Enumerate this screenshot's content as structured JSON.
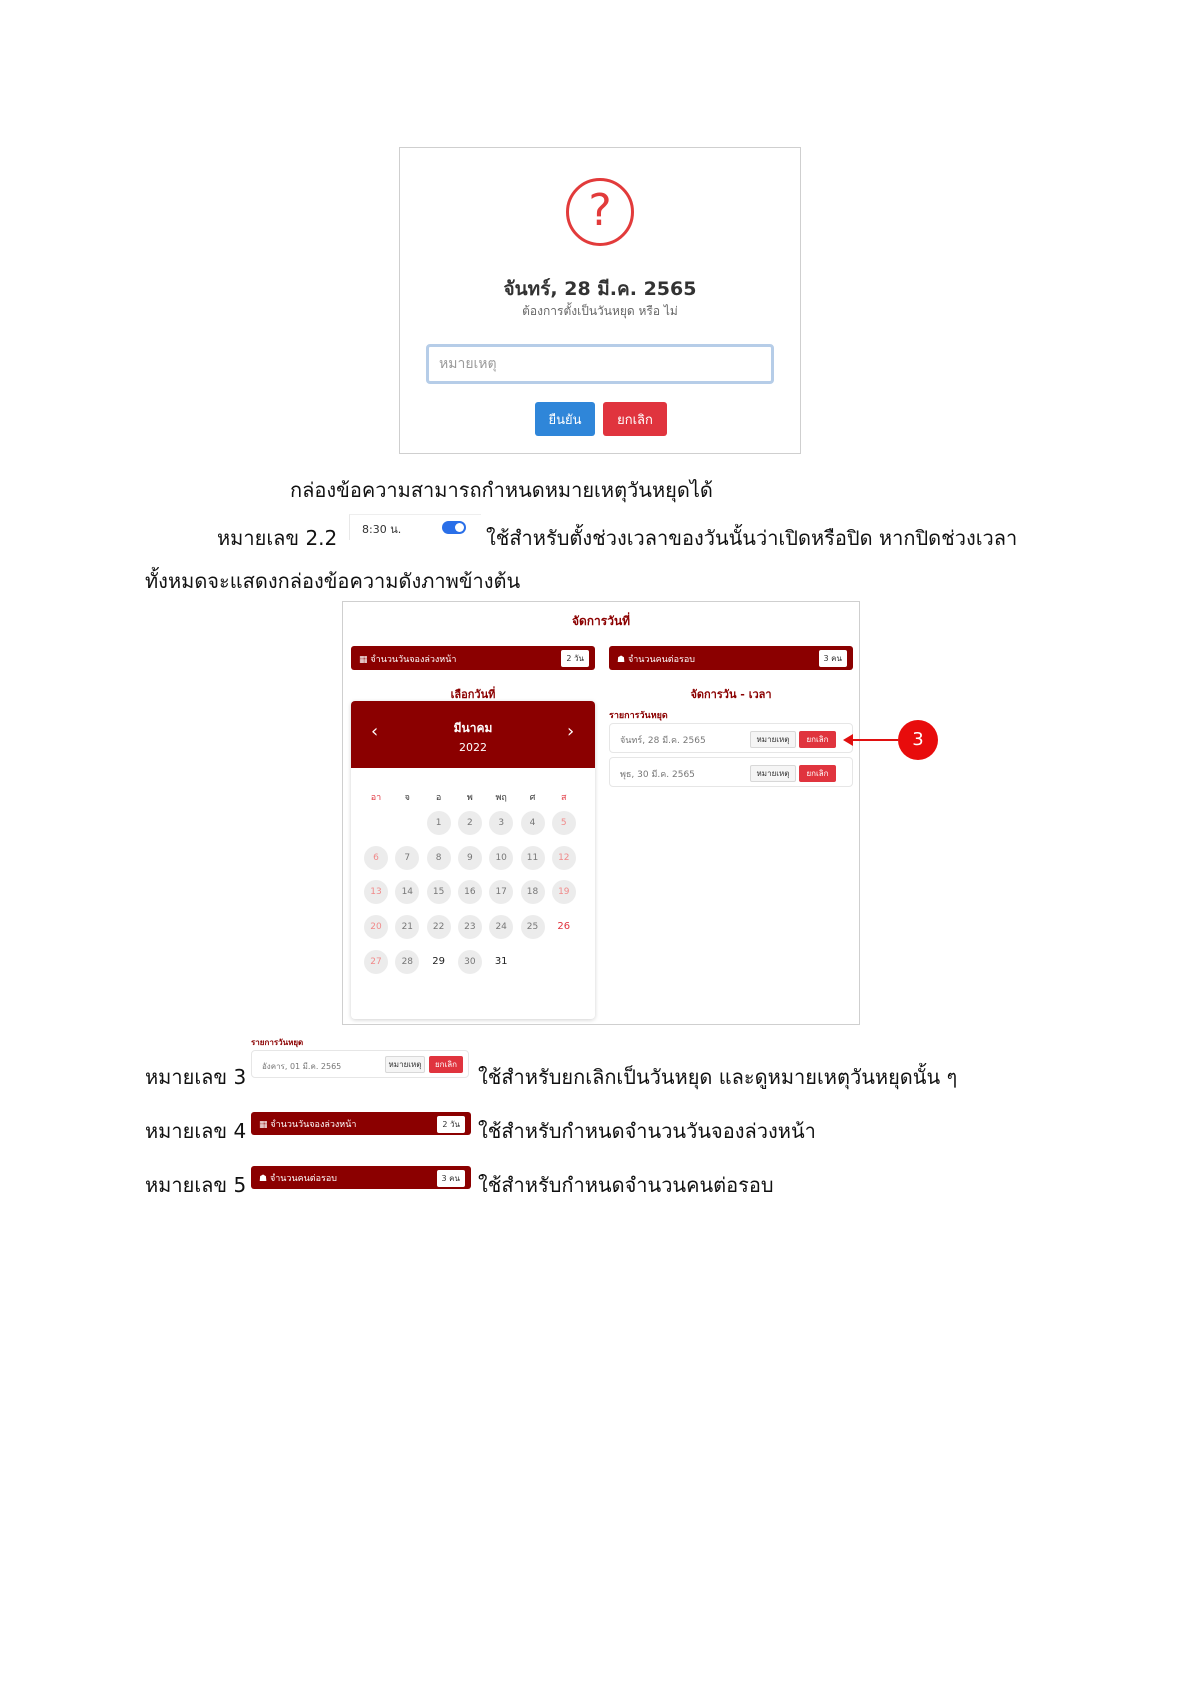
{
  "dialog": {
    "icon": "question-icon",
    "icon_glyph": "?",
    "title": "จันทร์, 28 มี.ค. 2565",
    "subtitle": "ต้องการตั้งเป็นวันหยุด หรือ ไม่",
    "input_placeholder": "หมายเหตุ",
    "confirm_label": "ยืนยัน",
    "cancel_label": "ยกเลิก"
  },
  "doc": {
    "caption": "กล่องข้อความสามารถกำหนดหมายเหตุวันหยุดได้",
    "item_22_label": "หมายเลข 2.2",
    "item_22_text": "ใช้สำหรับตั้งช่วงเวลาของวันนั้นว่าเปิดหรือปิด หากปิดช่วงเวลา",
    "item_22_text2": "ทั้งหมดจะแสดงกล่องข้อความดังภาพข้างต้น",
    "time_slot": "8:30 น.",
    "item_3_label": "หมายเลข 3",
    "item_3_text": "ใช้สำหรับยกเลิกเป็นวันหยุด และดูหมายเหตุวันหยุดนั้น ๆ",
    "item_4_label": "หมายเลข 4",
    "item_4_text": "ใช้สำหรับกำหนดจำนวนวันจองล่วงหน้า",
    "item_5_label": "หมายเลข 5",
    "item_5_text": "ใช้สำหรับกำหนดจำนวนคนต่อรอบ"
  },
  "manage": {
    "title": "จัดการวันที่",
    "advance_days_label": "จำนวนวันจองล่วงหน้า",
    "advance_days_badge": "2 วัน",
    "per_round_label": "จำนวนคนต่อรอบ",
    "per_round_badge": "3 คน",
    "select_day_title": "เลือกวันที่",
    "manage_day_title": "จัดการวัน - เวลา",
    "month": "มีนาคม",
    "year": "2022",
    "prev": "‹",
    "next": "›",
    "weekdays": [
      "อา",
      "จ",
      "อ",
      "พ",
      "พฤ",
      "ศ",
      "ส"
    ],
    "holiday_list_title": "รายการวันหยุด",
    "holidays": [
      {
        "date": "จันทร์, 28 มี.ค. 2565",
        "note_label": "หมายเหตุ",
        "cancel_label": "ยกเลิก"
      },
      {
        "date": "พุธ, 30 มี.ค. 2565",
        "note_label": "หมายเหตุ",
        "cancel_label": "ยกเลิก"
      }
    ],
    "annotation_number": "3"
  },
  "snippet3": {
    "title": "รายการวันหยุด",
    "date": "อังคาร, 01 มี.ค. 2565",
    "note_label": "หมายเหตุ",
    "cancel_label": "ยกเลิก"
  },
  "snippet4": {
    "label": "จำนวนวันจองล่วงหน้า",
    "badge": "2 วัน"
  },
  "snippet5": {
    "label": "จำนวนคนต่อรอบ",
    "badge": "3 คน"
  }
}
